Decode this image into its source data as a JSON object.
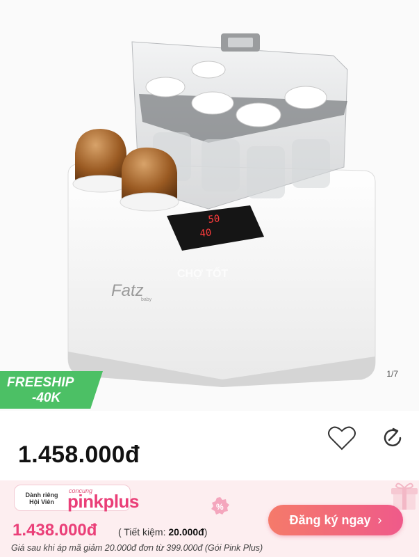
{
  "gallery": {
    "counter": "1/7",
    "watermark": "CHỢ TỐT",
    "brand_logo": "Fatz",
    "brand_logo_sub": "baby",
    "display_top": "50",
    "display_bottom": "40"
  },
  "promo": {
    "freeship_line1": "FREESHIP",
    "freeship_line2": "-40K"
  },
  "product": {
    "price": "1.458.000đ"
  },
  "actions": {
    "favorite_icon": "heart-icon",
    "share_icon": "share-icon"
  },
  "member": {
    "badge_small": "Dành riêng Hội Viên",
    "badge_brand": "concung",
    "badge_pink": "pink",
    "badge_plus": "plus",
    "member_price": "1.438.000đ",
    "saving_label": "( Tiết kiệm: ",
    "saving_value": "20.000đ",
    "saving_close": ")",
    "register_label": "Đăng ký ngay",
    "note": "Giá sau khi áp mã giảm 20.000đ đơn từ 399.000đ (Gói Pink Plus)"
  },
  "colors": {
    "pink_accent": "#ea3f78",
    "freeship_green": "#4cc065",
    "banner_bg": "#fdeef0"
  }
}
